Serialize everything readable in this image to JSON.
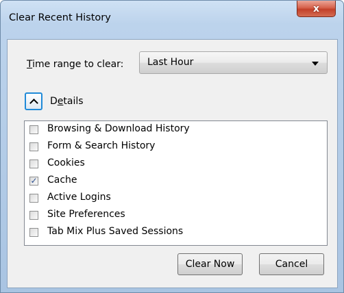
{
  "window": {
    "title": "Clear Recent History",
    "close_glyph": "x"
  },
  "time_range": {
    "label_accesskey": "T",
    "label_rest": "ime range to clear:",
    "value": "Last Hour"
  },
  "details": {
    "label_first": "D",
    "label_accesskey": "e",
    "label_rest": "tails"
  },
  "items": [
    {
      "label": "Browsing & Download History",
      "checked": false
    },
    {
      "label": "Form & Search History",
      "checked": false
    },
    {
      "label": "Cookies",
      "checked": false
    },
    {
      "label": "Cache",
      "checked": true
    },
    {
      "label": "Active Logins",
      "checked": false
    },
    {
      "label": "Site Preferences",
      "checked": false
    },
    {
      "label": "Tab Mix Plus Saved Sessions",
      "checked": false
    }
  ],
  "buttons": {
    "clear_now": "Clear Now",
    "cancel": "Cancel"
  },
  "colors": {
    "close_button": "#c7472f",
    "focus_ring": "#1f8ad8",
    "window_frame": "#b9d1ea"
  }
}
